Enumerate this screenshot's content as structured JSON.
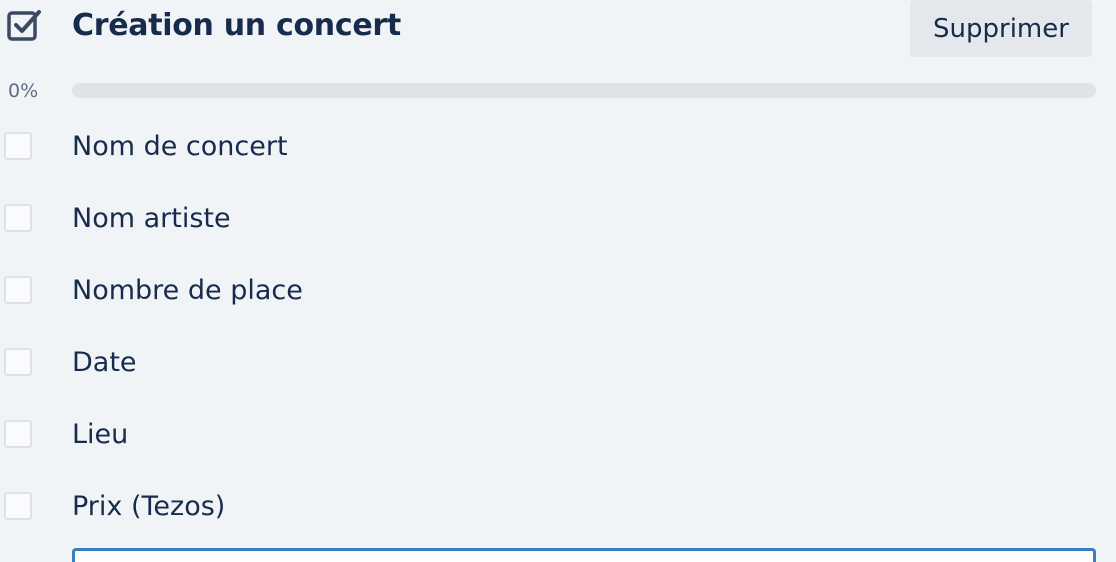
{
  "checklist": {
    "title": "Création un concert",
    "delete_label": "Supprimer",
    "progress": {
      "percent_text": "0%",
      "fraction": 0
    },
    "items": [
      {
        "label": "Nom de concert",
        "checked": false
      },
      {
        "label": "Nom artiste",
        "checked": false
      },
      {
        "label": "Nombre de place",
        "checked": false
      },
      {
        "label": "Date",
        "checked": false
      },
      {
        "label": "Lieu",
        "checked": false
      },
      {
        "label": "Prix (Tezos)",
        "checked": false
      }
    ],
    "header_icon": "checklist-icon"
  },
  "colors": {
    "background": "#f1f4f7",
    "text": "#172b4d",
    "button_bg": "#e4e7eb",
    "progress_track": "#dfe3e8",
    "input_border": "#3b7bbf"
  }
}
